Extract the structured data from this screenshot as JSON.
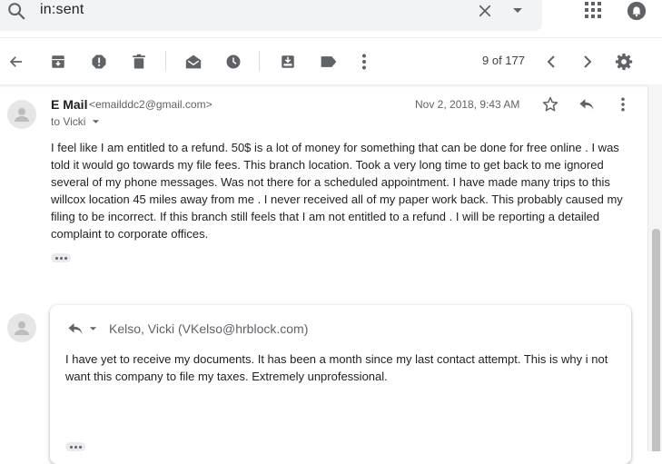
{
  "search": {
    "query": "in:sent"
  },
  "toolbar": {
    "page_counter": "9 of 177",
    "icons": [
      "back-arrow-icon",
      "archive-icon",
      "report-spam-icon",
      "delete-icon",
      "mark-unread-icon",
      "snooze-icon",
      "move-to-icon",
      "label-icon",
      "more-vert-icon",
      "chevron-left-icon",
      "chevron-right-icon",
      "settings-icon"
    ]
  },
  "message": {
    "sender_name": "E Mail",
    "sender_email": "<emailddc2@gmail.com>",
    "recipient": "to Vicki",
    "date": "Nov 2, 2018, 9:43 AM",
    "body": "I feel like I am entitled to a refund. 50$ is a lot of money for something that can be done for free online . I was told it would go towards my file fees. This branch location. Took a very long time to get back to me ignored several of my phone messages. Was not there for a scheduled appointment. I have made many trips to this willcox location 45 miles away from me . I never received all of my paper work back. This probably caused my filing to be incorrect. If this branch still feels that I am not entitled to a refund . I will be reporting a detailed complaint to corporate offices."
  },
  "reply": {
    "to": "Kelso, Vicki (VKelso@hrblock.com)",
    "body": "I have yet to receive my documents. It has been a month since my last contact attempt. This is why i not want this company to file my taxes. Extremely unprofessional."
  },
  "colors": {
    "icon": "#5f6368",
    "search_bg": "#f1f3f4",
    "text": "#202124"
  }
}
